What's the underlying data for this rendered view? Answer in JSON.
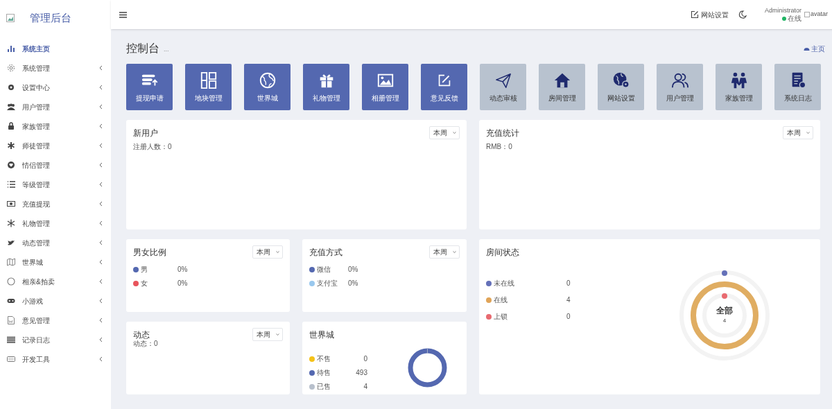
{
  "sidebar": {
    "title": "管理后台",
    "items": [
      {
        "label": "系统主页",
        "selected": true,
        "expandable": false
      },
      {
        "label": "系统管理",
        "selected": false,
        "expandable": true
      },
      {
        "label": "设置中心",
        "selected": false,
        "expandable": true
      },
      {
        "label": "用户管理",
        "selected": false,
        "expandable": true
      },
      {
        "label": "家族管理",
        "selected": false,
        "expandable": true
      },
      {
        "label": "师徒管理",
        "selected": false,
        "expandable": true
      },
      {
        "label": "情侣管理",
        "selected": false,
        "expandable": true
      },
      {
        "label": "等级管理",
        "selected": false,
        "expandable": true
      },
      {
        "label": "充值提现",
        "selected": false,
        "expandable": true
      },
      {
        "label": "礼物管理",
        "selected": false,
        "expandable": true
      },
      {
        "label": "动态管理",
        "selected": false,
        "expandable": true
      },
      {
        "label": "世界城",
        "selected": false,
        "expandable": true
      },
      {
        "label": "相亲&拍卖",
        "selected": false,
        "expandable": true
      },
      {
        "label": "小游戏",
        "selected": false,
        "expandable": true
      },
      {
        "label": "意见管理",
        "selected": false,
        "expandable": true
      },
      {
        "label": "记录日志",
        "selected": false,
        "expandable": true
      },
      {
        "label": "开发工具",
        "selected": false,
        "expandable": true
      }
    ]
  },
  "header": {
    "site_settings": "网站设置",
    "user": "Administrator",
    "status": "在线",
    "avatar_alt": "avatar"
  },
  "page": {
    "title": "控制台",
    "subtitle": "...",
    "breadcrumb": "主页"
  },
  "shortcuts": [
    {
      "label": "提现申请",
      "kind": "primary"
    },
    {
      "label": "地块管理",
      "kind": "primary"
    },
    {
      "label": "世界城",
      "kind": "primary"
    },
    {
      "label": "礼物管理",
      "kind": "primary"
    },
    {
      "label": "相册管理",
      "kind": "primary"
    },
    {
      "label": "意见反馈",
      "kind": "primary"
    },
    {
      "label": "动态审核",
      "kind": "muted"
    },
    {
      "label": "房间管理",
      "kind": "muted"
    },
    {
      "label": "网站设置",
      "kind": "muted"
    },
    {
      "label": "用户管理",
      "kind": "muted"
    },
    {
      "label": "家族管理",
      "kind": "muted"
    },
    {
      "label": "系统日志",
      "kind": "muted"
    }
  ],
  "new_users": {
    "title": "新用户",
    "period": "本周",
    "stat": "注册人数：0"
  },
  "recharge_stats": {
    "title": "充值统计",
    "period": "本周",
    "stat": "RMB：0"
  },
  "gender_ratio": {
    "title": "男女比例",
    "period": "本周",
    "legend": [
      {
        "label": "男",
        "value": "0%",
        "color": "#5468b0"
      },
      {
        "label": "女",
        "value": "0%",
        "color": "#e8545c"
      }
    ]
  },
  "recharge_method": {
    "title": "充值方式",
    "period": "本周",
    "legend": [
      {
        "label": "微信",
        "value": "0%",
        "color": "#5468b0"
      },
      {
        "label": "支付宝",
        "value": "0%",
        "color": "#99c8ee"
      }
    ]
  },
  "room_status": {
    "title": "房间状态",
    "legend": [
      {
        "label": "未在线",
        "value": "0",
        "color": "#6470b8"
      },
      {
        "label": "在线",
        "value": "4",
        "color": "#e0a458"
      },
      {
        "label": "上锁",
        "value": "0",
        "color": "#e86a70"
      }
    ],
    "center_label": "全部",
    "center_value": "4"
  },
  "moments": {
    "title": "动态",
    "period": "本周",
    "stat": "动态：0"
  },
  "world_city": {
    "title": "世界城",
    "legend": [
      {
        "label": "不售",
        "value": "0",
        "color": "#f5c218"
      },
      {
        "label": "待售",
        "value": "493",
        "color": "#5468b0"
      },
      {
        "label": "已售",
        "value": "4",
        "color": "#b8c0cc"
      }
    ]
  }
}
